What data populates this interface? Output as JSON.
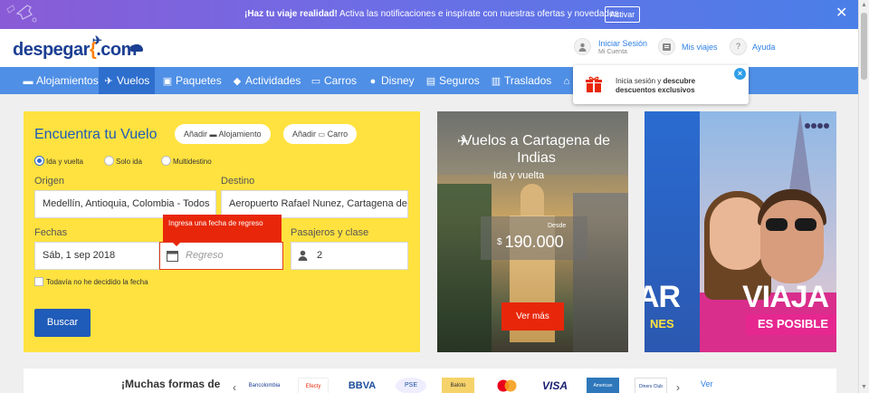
{
  "notification": {
    "message_bold": "¡Haz tu viaje realidad!",
    "message": " Activa las notificaciones e inspírate con nuestras ofertas y novedades.",
    "action_label": "Activar",
    "close": "✕"
  },
  "header": {
    "logo_text_1": "despegar",
    "logo_text_2": ".com",
    "login_label": "Iniciar Sesión",
    "login_sub": "Mi Cuenta",
    "trips_label": "Mis viajes",
    "help_label": "Ayuda",
    "help_icon_glyph": "?"
  },
  "nav": {
    "items": [
      {
        "label": "Alojamientos",
        "icon": "bed-icon"
      },
      {
        "label": "Vuelos",
        "icon": "plane-icon"
      },
      {
        "label": "Paquetes",
        "icon": "suitcase-icon"
      },
      {
        "label": "Actividades",
        "icon": "ticket-icon"
      },
      {
        "label": "Carros",
        "icon": "car-icon"
      },
      {
        "label": "Disney",
        "icon": "mickey-icon"
      },
      {
        "label": "Seguros",
        "icon": "shield-icon"
      },
      {
        "label": "Traslados",
        "icon": "bus-icon"
      }
    ],
    "active": "Vuelos"
  },
  "promo_popup": {
    "text_1": "Inicia sesión y ",
    "text_bold_1": "descubre",
    "text_bold_2": "descuentos exclusivos",
    "close": "×"
  },
  "search": {
    "title": "Encuentra tu Vuelo",
    "add_hotel": "Añadir",
    "add_hotel_suffix": "Alojamiento",
    "add_car": "Añadir",
    "add_car_suffix": "Carro",
    "trip_types": [
      "Ida y vuelta",
      "Solo ida",
      "Multidestino"
    ],
    "selected_trip_type": "Ida y vuelta",
    "origin_label": "Origen",
    "origin_value": "Medellín, Antioquia, Colombia - Todos",
    "destination_label": "Destino",
    "destination_value": "Aeropuerto Rafael Nunez, Cartagena de",
    "dates_label": "Fechas",
    "depart_value": "Sáb, 1 sep 2018",
    "return_placeholder": "Regreso",
    "error_tooltip": "Ingresa una fecha de regreso",
    "passengers_label": "Pasajeros y clase",
    "passengers_value": "2",
    "undecided_label": "Todavía no he decidido la fecha",
    "submit_label": "Buscar"
  },
  "card_cartagena": {
    "title": "Vuelos a Cartagena de Indias",
    "subtitle": "Ida y vuelta",
    "from_label": "Desde",
    "currency": "$",
    "price": "190.000",
    "cta": "Ver más"
  },
  "card_paris": {
    "word_left": "AR",
    "word_right": "VIAJA",
    "tag_left": "NES",
    "tag_right": "ES POSIBLE"
  },
  "payments": {
    "title": "¡Muchas formas de",
    "logos": [
      "Bancolombia",
      "Efecty",
      "BBVA",
      "PSE",
      "Baloto",
      "Mastercard",
      "VISA",
      "American Express",
      "Diners Club"
    ],
    "see_more": "Ver",
    "prev": "‹",
    "next": "›"
  },
  "colors": {
    "brand_blue": "#1b3f93",
    "nav_blue": "#4f8fe6",
    "search_yellow": "#ffe23f",
    "error_red": "#e8270a"
  }
}
